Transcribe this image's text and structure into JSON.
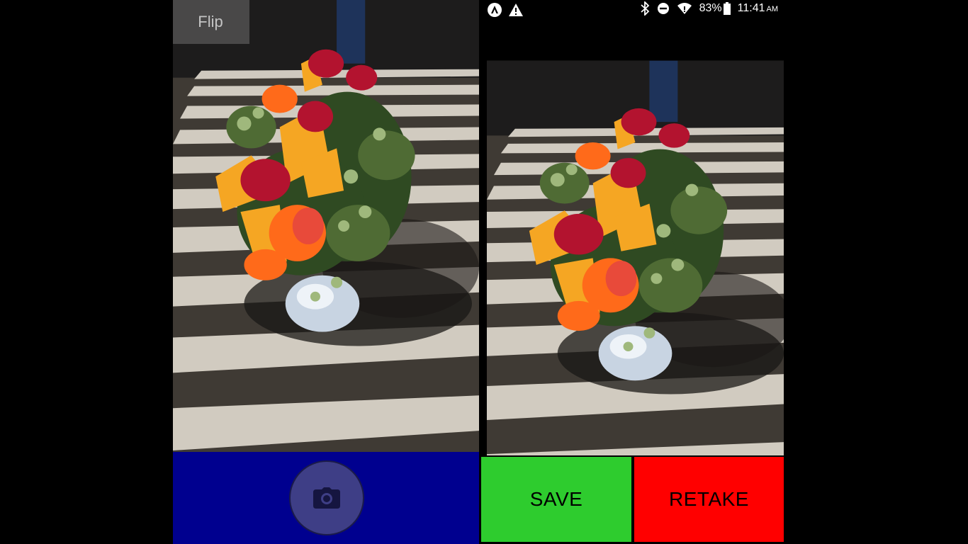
{
  "camera": {
    "flip_label": "Flip",
    "shutter_icon": "camera-icon",
    "capture_bar_color": "#00008f"
  },
  "preview": {
    "status_bar": {
      "left_icons": [
        "app-notification-icon",
        "warning-icon"
      ],
      "right_icons": [
        "bluetooth-icon",
        "do-not-disturb-icon",
        "wifi-icon",
        "battery-icon"
      ],
      "battery_percent": "83%",
      "time": "11:41",
      "ampm": "AM"
    },
    "save_label": "SAVE",
    "retake_label": "RETAKE",
    "save_color": "#2ecc2e",
    "retake_color": "#ff0000"
  }
}
